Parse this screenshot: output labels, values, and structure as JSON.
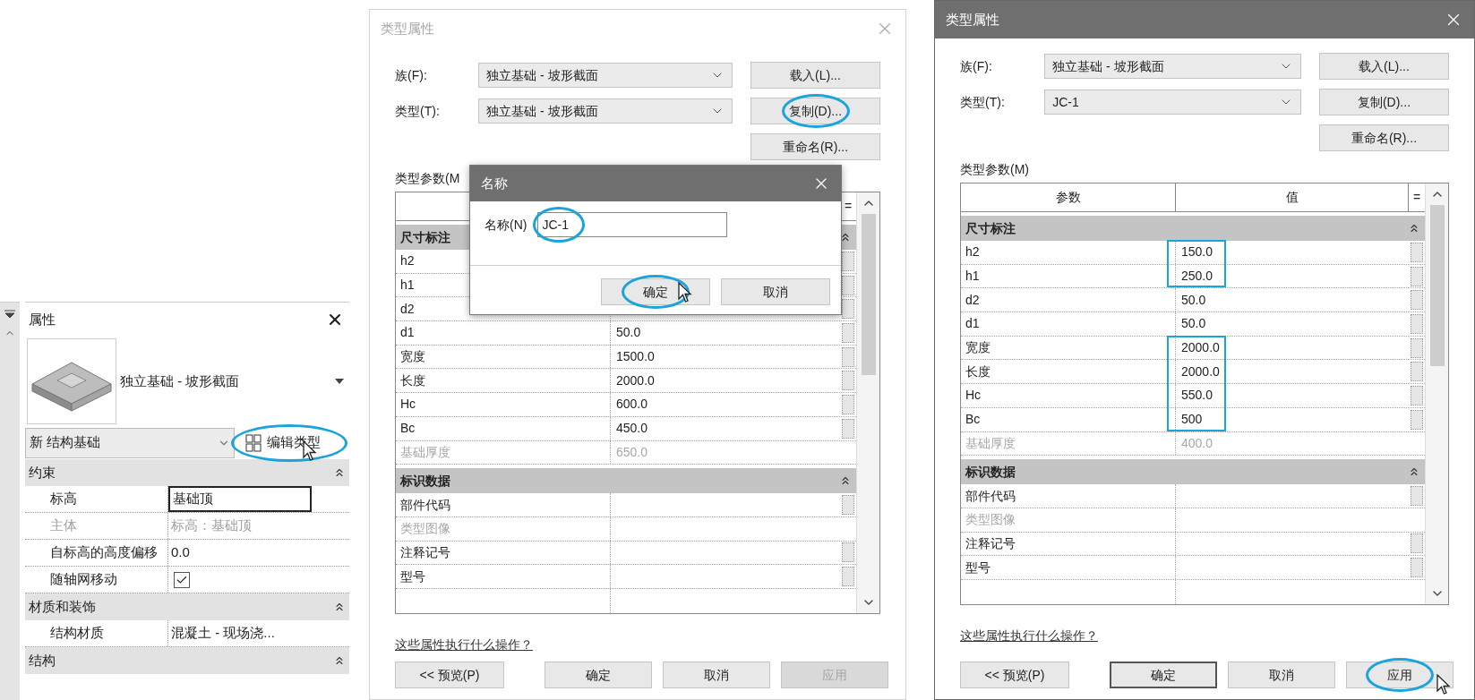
{
  "properties_panel": {
    "title": "属性",
    "type_name": "独立基础 - 坡形截面",
    "instance_filter": "新 结构基础",
    "edit_type_button": {
      "label": "编辑类型",
      "circled": true
    },
    "sections": [
      {
        "title": "约束",
        "rows": [
          {
            "label": "标高",
            "kind": "text",
            "value": "基础顶",
            "focused": true,
            "disabled": false
          },
          {
            "label": "主体",
            "kind": "text",
            "value": "标高：基础顶",
            "focused": false,
            "disabled": true
          },
          {
            "label": "自标高的高度偏移",
            "kind": "text",
            "value": "0.0",
            "focused": false,
            "disabled": false
          },
          {
            "label": "随轴网移动",
            "kind": "checkbox",
            "checked": true,
            "disabled": false
          }
        ]
      },
      {
        "title": "材质和装饰",
        "rows": [
          {
            "label": "结构材质",
            "kind": "text",
            "value": "混凝土 - 现场浇...",
            "focused": false,
            "disabled": false
          }
        ]
      },
      {
        "title": "结构"
      }
    ]
  },
  "type_dialog_before": {
    "title": "类型属性",
    "active": false,
    "fields": [
      {
        "label": "族(F):",
        "value": "独立基础 - 坡形截面"
      },
      {
        "label": "类型(T):",
        "value": "独立基础 - 坡形截面"
      }
    ],
    "side_buttons": [
      {
        "label": "载入(L)...",
        "circled": false
      },
      {
        "label": "复制(D)...",
        "circled": true
      },
      {
        "label": "重命名(R)...",
        "circled": false
      }
    ],
    "params_label": "类型参数(M",
    "header": {
      "link": "="
    },
    "sections": [
      {
        "title": "尺寸标注",
        "rows": [
          {
            "name": "h2",
            "disabled": false
          },
          {
            "name": "h1",
            "disabled": false
          },
          {
            "name": "d2",
            "disabled": false
          },
          {
            "name": "d1",
            "value": "50.0",
            "disabled": false
          },
          {
            "name": "宽度",
            "value": "1500.0",
            "disabled": false
          },
          {
            "name": "长度",
            "value": "2000.0",
            "disabled": false
          },
          {
            "name": "Hc",
            "value": "600.0",
            "disabled": false
          },
          {
            "name": "Bc",
            "value": "450.0",
            "disabled": false
          },
          {
            "name": "基础厚度",
            "value": "650.0",
            "disabled": true
          }
        ]
      },
      {
        "title": "标识数据",
        "rows": [
          {
            "name": "部件代码",
            "disabled": false
          },
          {
            "name": "类型图像",
            "disabled": true
          },
          {
            "name": "注释记号",
            "disabled": false
          },
          {
            "name": "型号",
            "disabled": false
          }
        ]
      }
    ],
    "help_link": "这些属性执行什么操作？",
    "buttons": [
      {
        "label": "<< 预览(P)",
        "disabled": false,
        "default": false,
        "circled": false
      },
      {
        "label": "确定",
        "disabled": false,
        "default": false,
        "circled": false
      },
      {
        "label": "取消",
        "disabled": false,
        "default": false,
        "circled": false
      },
      {
        "label": "应用",
        "disabled": true,
        "default": false,
        "circled": false
      }
    ],
    "name_dialog": {
      "title": "名称",
      "field_label": "名称(N)",
      "value": "JC-1",
      "circled": true,
      "buttons": [
        {
          "label": "确定",
          "circled": true
        },
        {
          "label": "取消",
          "circled": false
        }
      ]
    }
  },
  "type_dialog_after": {
    "title": "类型属性",
    "active": true,
    "fields": [
      {
        "label": "族(F):",
        "value": "独立基础 - 坡形截面"
      },
      {
        "label": "类型(T):",
        "value": "JC-1"
      }
    ],
    "side_buttons": [
      {
        "label": "载入(L)...",
        "circled": false
      },
      {
        "label": "复制(D)...",
        "circled": false
      },
      {
        "label": "重命名(R)...",
        "circled": false
      }
    ],
    "params_label": "类型参数(M)",
    "header": {
      "param": "参数",
      "value": "值",
      "link": "="
    },
    "sections": [
      {
        "title": "尺寸标注",
        "rows": [
          {
            "name": "h2",
            "value": "150.0",
            "disabled": false,
            "boxed": true
          },
          {
            "name": "h1",
            "value": "250.0",
            "disabled": false,
            "boxed": true
          },
          {
            "name": "d2",
            "value": "50.0",
            "disabled": false,
            "boxed": false
          },
          {
            "name": "d1",
            "value": "50.0",
            "disabled": false,
            "boxed": false
          },
          {
            "name": "宽度",
            "value": "2000.0",
            "disabled": false,
            "boxed": true
          },
          {
            "name": "长度",
            "value": "2000.0",
            "disabled": false,
            "boxed": true
          },
          {
            "name": "Hc",
            "value": "550.0",
            "disabled": false,
            "boxed": true
          },
          {
            "name": "Bc",
            "value": "500",
            "disabled": false,
            "boxed": true
          },
          {
            "name": "基础厚度",
            "value": "400.0",
            "disabled": true,
            "boxed": false
          }
        ]
      },
      {
        "title": "标识数据",
        "rows": [
          {
            "name": "部件代码",
            "disabled": false,
            "boxed": false
          },
          {
            "name": "类型图像",
            "disabled": true,
            "boxed": false
          },
          {
            "name": "注释记号",
            "disabled": false,
            "boxed": false
          },
          {
            "name": "型号",
            "disabled": false,
            "boxed": false
          }
        ]
      }
    ],
    "help_link": "这些属性执行什么操作？",
    "buttons": [
      {
        "label": "<< 预览(P)",
        "disabled": false,
        "default": false,
        "circled": false
      },
      {
        "label": "确定",
        "disabled": false,
        "default": true,
        "circled": false
      },
      {
        "label": "取消",
        "disabled": false,
        "default": false,
        "circled": false
      },
      {
        "label": "应用",
        "disabled": false,
        "default": false,
        "circled": true
      }
    ]
  }
}
